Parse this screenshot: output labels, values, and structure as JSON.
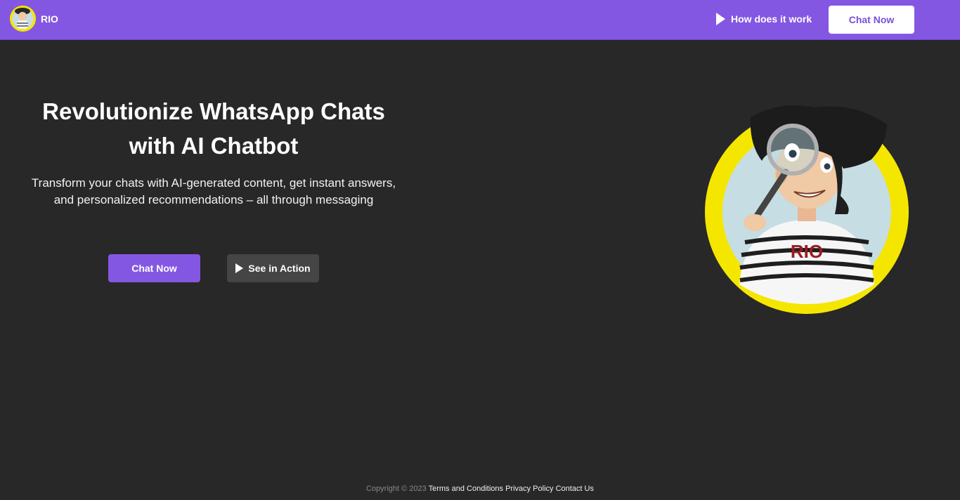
{
  "header": {
    "brand_name": "RIO",
    "nav_link": "How does it work",
    "cta_label": "Chat Now"
  },
  "hero": {
    "title_line1": "Revolutionize WhatsApp Chats",
    "title_line2": "with AI Chatbot",
    "subtitle_line1": "Transform your chats with AI-generated content, get instant answers,",
    "subtitle_line2": "and personalized recommendations – all through messaging",
    "primary_button": "Chat Now",
    "secondary_button": "See in Action",
    "mascot_shirt_text": "RIO"
  },
  "footer": {
    "copyright": "Copyright © 2023",
    "links": [
      "Terms and Conditions",
      "Privacy Policy",
      "Contact Us"
    ]
  },
  "colors": {
    "brand_purple": "#8457e3",
    "background": "#282828",
    "secondary_button": "#454545",
    "mascot_ring": "#f5e600",
    "mascot_bg": "#c6dde3"
  },
  "icons": [
    "play-icon",
    "avatar-icon",
    "magnifier-icon"
  ]
}
